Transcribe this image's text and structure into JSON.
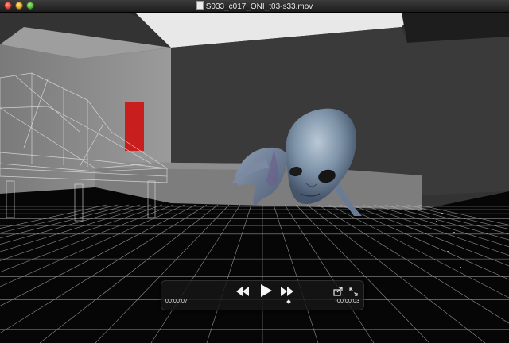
{
  "window": {
    "title": "S033_c017_ONI_t03-s33.mov"
  },
  "icons": {
    "close": "close-button",
    "minimize": "minimize-button",
    "zoom": "zoom-button",
    "document": "movie-file-icon",
    "rewind": "rewind-icon",
    "play": "play-icon",
    "fast_forward": "fast-forward-icon",
    "share": "share-icon",
    "fullscreen": "fullscreen-icon"
  },
  "controls": {
    "elapsed": "00:00:07",
    "remaining": "-00:00:03",
    "progress_fraction": 0.7
  }
}
